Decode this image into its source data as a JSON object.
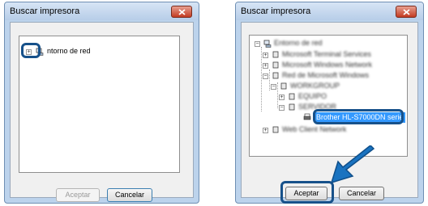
{
  "dialogs": [
    {
      "title": "Buscar impresora",
      "tree": {
        "root_label": "ntorno de red"
      },
      "buttons": {
        "accept": "Aceptar",
        "cancel": "Cancelar"
      }
    },
    {
      "title": "Buscar impresora",
      "tree": {
        "blurred_labels": [
          "Entorno de red",
          "Microsoft Terminal Services",
          "Microsoft Windows Network",
          "Red de Microsoft Windows",
          "WORKGROUP",
          "EQUIPO",
          "SERVIDOR",
          "Web Client Network"
        ],
        "selected_label": "Brother HL-S7000DN serie"
      },
      "buttons": {
        "accept": "Aceptar",
        "cancel": "Cancelar"
      }
    }
  ],
  "colors": {
    "callout": "#17518a",
    "arrow": "#1a73c0",
    "selection": "#3399ff",
    "close": "#c33a22"
  },
  "icons": [
    "expand-plus-icon",
    "network-computer-icon",
    "printer-icon",
    "close-x-icon",
    "arrow-pointer-icon"
  ]
}
